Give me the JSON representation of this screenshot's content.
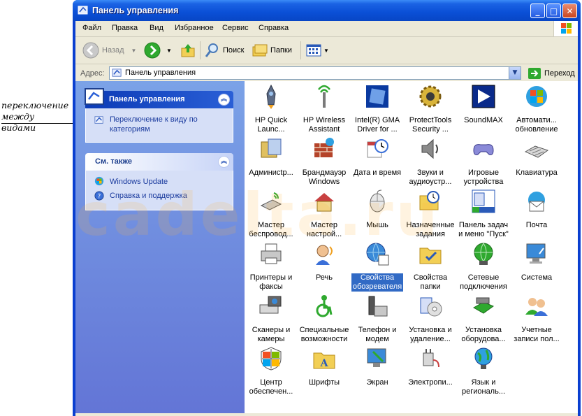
{
  "annotation": {
    "line1": "переключение",
    "line2": "между видами"
  },
  "window": {
    "title": "Панель управления"
  },
  "menu": [
    "Файл",
    "Правка",
    "Вид",
    "Избранное",
    "Сервис",
    "Справка"
  ],
  "toolbar": {
    "back": "Назад",
    "search": "Поиск",
    "folders": "Папки"
  },
  "address": {
    "label": "Адрес:",
    "value": "Панель управления",
    "go": "Переход"
  },
  "taskpane": {
    "panel1": {
      "title": "Панель управления",
      "link1": "Переключение к виду по",
      "link2": "категориям"
    },
    "panel2": {
      "title": "См. также",
      "link1": "Windows Update",
      "link2": "Справка и поддержка"
    }
  },
  "items": [
    {
      "l1": "HP Quick",
      "l2": "Launc..."
    },
    {
      "l1": "HP Wireless",
      "l2": "Assistant"
    },
    {
      "l1": "Intel(R) GMA",
      "l2": "Driver for ..."
    },
    {
      "l1": "ProtectTools",
      "l2": "Security ..."
    },
    {
      "l1": "SoundMAX",
      "l2": ""
    },
    {
      "l1": "Автомати...",
      "l2": "обновление"
    },
    {
      "l1": "Админисtp...",
      "l2": ""
    },
    {
      "l1": "Брандмауэр",
      "l2": "Windows"
    },
    {
      "l1": "Дата и время",
      "l2": ""
    },
    {
      "l1": "Звуки и",
      "l2": "аудиоустр..."
    },
    {
      "l1": "Игровые",
      "l2": "устройства"
    },
    {
      "l1": "Клавиатура",
      "l2": ""
    },
    {
      "l1": "Мастер",
      "l2": "беспровод..."
    },
    {
      "l1": "Мастер",
      "l2": "настрой..."
    },
    {
      "l1": "Мышь",
      "l2": ""
    },
    {
      "l1": "Назначенные",
      "l2": "задания"
    },
    {
      "l1": "Панель задач",
      "l2": "и меню \"Пуск\""
    },
    {
      "l1": "Почта",
      "l2": ""
    },
    {
      "l1": "Принтеры и",
      "l2": "факсы"
    },
    {
      "l1": "Речь",
      "l2": ""
    },
    {
      "l1": "Свойства",
      "l2": "обозревателя"
    },
    {
      "l1": "Свойства",
      "l2": "папки"
    },
    {
      "l1": "Сетевые",
      "l2": "подключения"
    },
    {
      "l1": "Система",
      "l2": ""
    },
    {
      "l1": "Сканеры и",
      "l2": "камеры"
    },
    {
      "l1": "Специальные",
      "l2": "возможности"
    },
    {
      "l1": "Телефон и",
      "l2": "модем"
    },
    {
      "l1": "Установка и",
      "l2": "удаление..."
    },
    {
      "l1": "Установка",
      "l2": "оборудова..."
    },
    {
      "l1": "Учетные",
      "l2": "записи пол..."
    },
    {
      "l1": "Центр",
      "l2": "обеспечен..."
    },
    {
      "l1": "Шрифты",
      "l2": ""
    },
    {
      "l1": "Экран",
      "l2": ""
    },
    {
      "l1": "Электропи...",
      "l2": ""
    },
    {
      "l1": "Язык и",
      "l2": "региональ..."
    }
  ],
  "watermark": "cadelta.ru"
}
